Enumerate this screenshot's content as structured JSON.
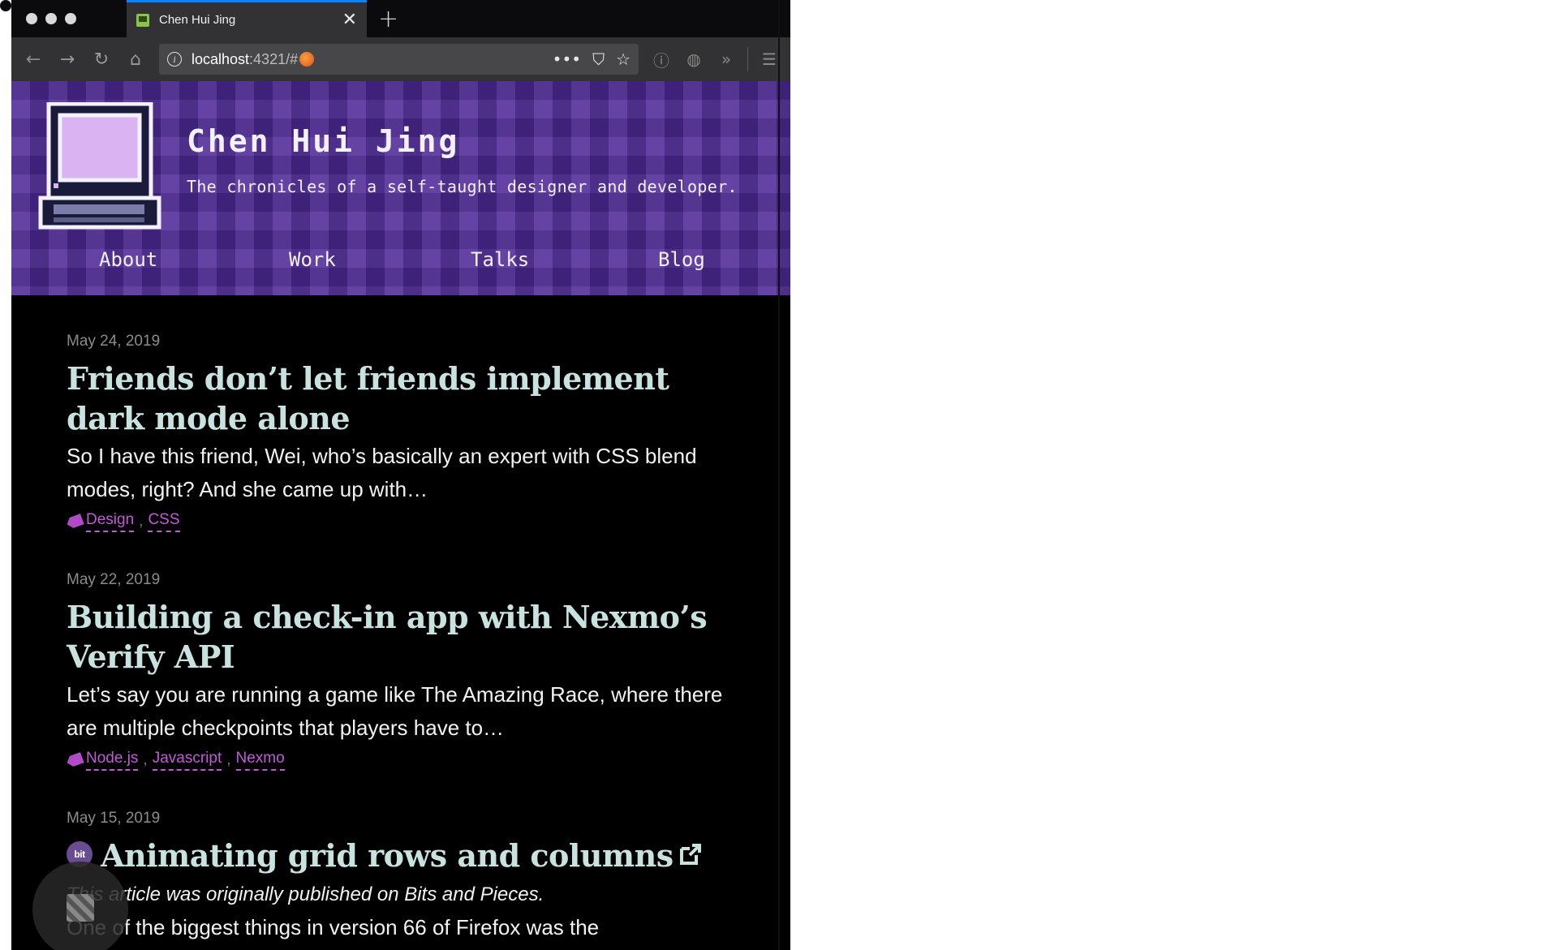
{
  "browser": {
    "tab_title": "Chen Hui Jing",
    "url_host": "localhost",
    "url_rest": ":4321/#",
    "traffic_light_colors": [
      "#ff5f57",
      "#febc2e",
      "#28c840"
    ],
    "traffic_light_colors_inactive": [
      "#d9d9d9",
      "#d9d9d9",
      "#d9d9d9"
    ]
  },
  "site": {
    "title": "Chen Hui Jing",
    "tagline": "The chronicles of a self-taught designer and developer.",
    "nav": [
      "About",
      "Work",
      "Talks",
      "Blog"
    ],
    "light_accent": "#4bb04f",
    "dark_accent": "#c25ad8",
    "light_header_color": "#a6d785",
    "dark_header_color": "#4f2a98"
  },
  "posts": [
    {
      "date": "May 24, 2019",
      "title": "Friends don’t let friends implement dark mode alone",
      "excerpt": "So I have this friend, Wei, who’s basically an expert with CSS blend modes, right? And she came up with…",
      "tags": [
        "Design",
        "CSS"
      ]
    },
    {
      "date": "May 22, 2019",
      "title": "Building a check-in app with Nexmo’s Verify API",
      "excerpt": "Let’s say you are running a game like The Amazing Race, where there are multiple checkpoints that players have to…",
      "tags": [
        "Node.js",
        "Javascript",
        "Nexmo"
      ]
    },
    {
      "date": "May 15, 2019",
      "badge": "bit",
      "title": "Animating grid rows and columns",
      "note": "This article was originally published on Bits and Pieces.",
      "excerpt": "One of the biggest things in version 66 of Firefox was the"
    }
  ],
  "icons": {
    "logo": "retro-computer-icon",
    "external_link": "external-link-icon",
    "tag": "tag-icon"
  }
}
